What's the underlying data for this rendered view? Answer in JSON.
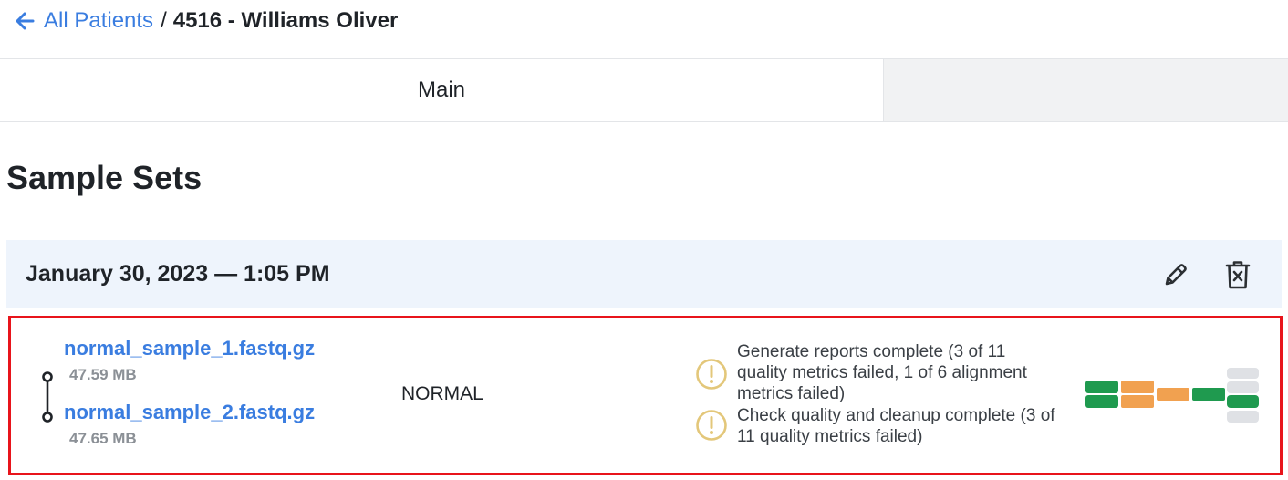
{
  "breadcrumb": {
    "back_label": "All Patients",
    "separator": "/",
    "current": "4516 - Williams Oliver"
  },
  "tabs": [
    {
      "label": "Main",
      "active": true
    },
    {
      "label": "",
      "active": false
    }
  ],
  "section": {
    "title": "Sample Sets"
  },
  "sample_set": {
    "title": "January 30, 2023 — 1:05 PM",
    "actions": {
      "edit_icon": "pencil-icon",
      "delete_icon": "trash-x-icon"
    },
    "row": {
      "files": [
        {
          "name": "normal_sample_1.fastq.gz",
          "size": "47.59 MB"
        },
        {
          "name": "normal_sample_2.fastq.gz",
          "size": "47.65 MB"
        }
      ],
      "type": "NORMAL",
      "statuses": [
        {
          "icon": "warning-circle-icon",
          "text": "Generate reports complete (3 of 11 quality metrics failed, 1 of 6 alignment metrics failed)"
        },
        {
          "icon": "warning-circle-icon",
          "text": "Check quality and cleanup complete (3 of 11 quality metrics failed)"
        }
      ]
    }
  },
  "colors": {
    "link": "#3a7de0",
    "highlight_border": "#e8141b",
    "set_header_bg": "#eef4fc",
    "warning": "#e3c77a",
    "step_green": "#1f9a4f",
    "step_orange": "#f1a150",
    "step_gray": "#dfe1e5"
  }
}
